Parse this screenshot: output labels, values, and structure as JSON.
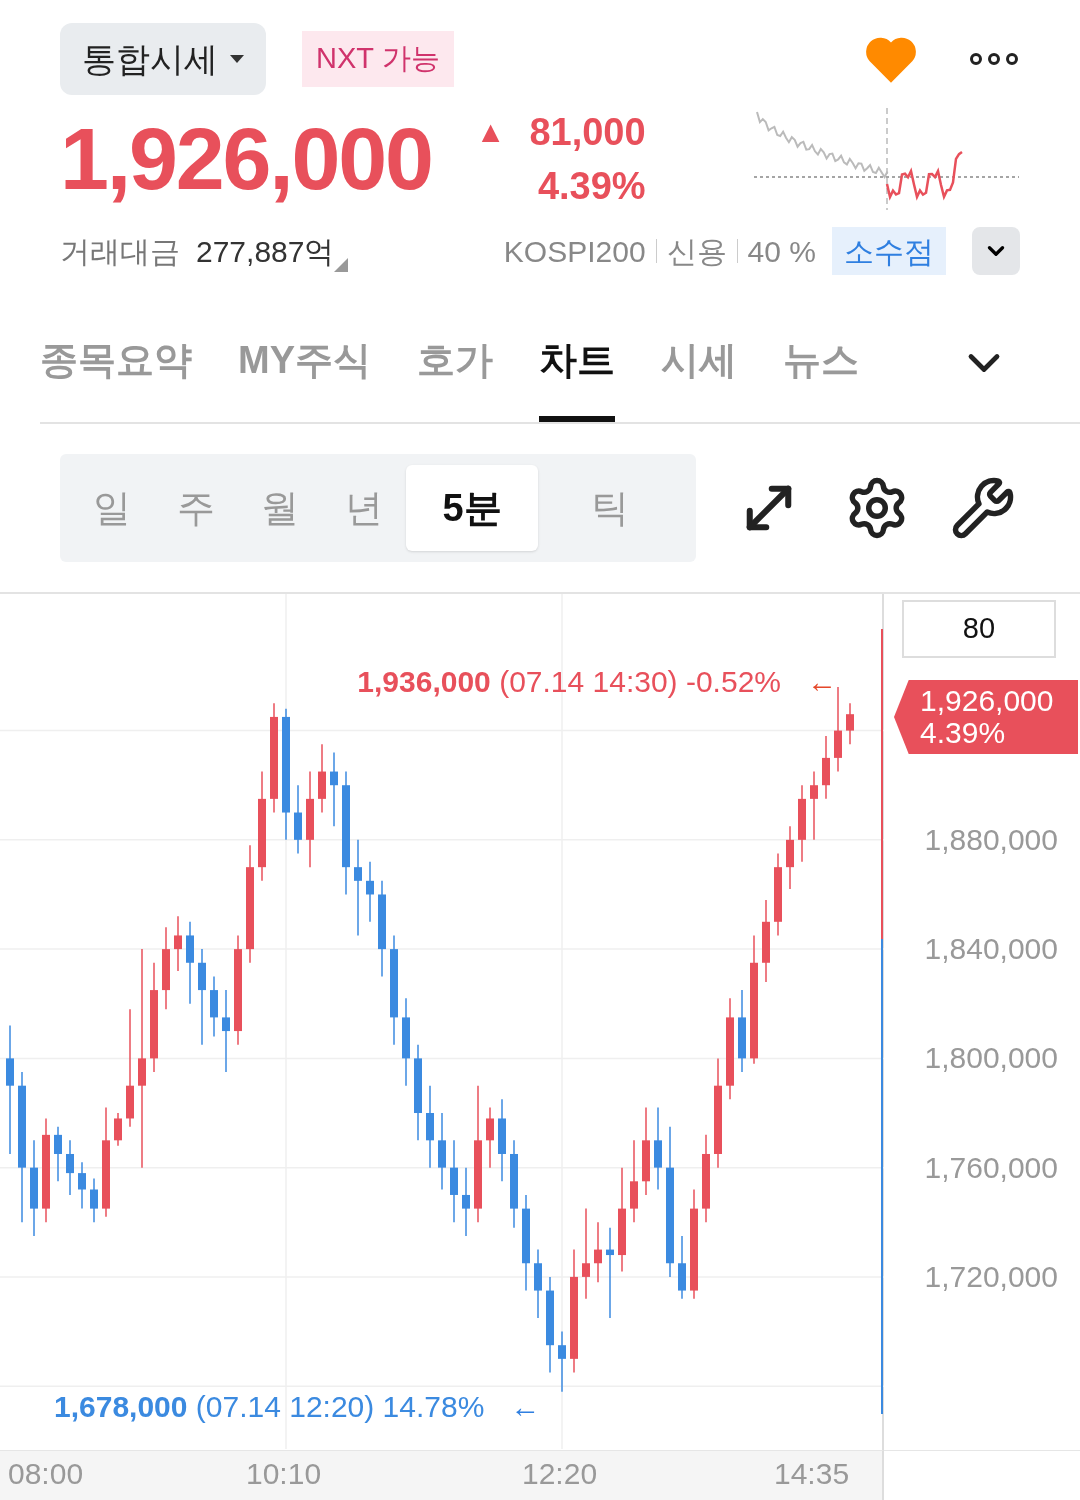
{
  "header": {
    "market_selector": "통합시세",
    "nxt_badge": "NXT 가능",
    "favorite": {
      "on": true
    },
    "price": "1,926,000",
    "change": {
      "arrow": "▲",
      "amount": "81,000",
      "percent": "4.39%"
    },
    "trade_value_label": "거래대금",
    "trade_value": "277,887억",
    "tags": [
      "KOSPI200",
      "신용",
      "40 %"
    ],
    "decimal_button": "소수점"
  },
  "tabs": [
    {
      "label": "종목요약",
      "selected": false
    },
    {
      "label": "MY주식",
      "selected": false
    },
    {
      "label": "호가",
      "selected": false
    },
    {
      "label": "차트",
      "selected": true
    },
    {
      "label": "시세",
      "selected": false
    },
    {
      "label": "뉴스",
      "selected": false
    }
  ],
  "periods": [
    {
      "label": "일",
      "selected": false
    },
    {
      "label": "주",
      "selected": false
    },
    {
      "label": "월",
      "selected": false
    },
    {
      "label": "년",
      "selected": false
    },
    {
      "label": "5분",
      "selected": true
    },
    {
      "label": "틱",
      "selected": false
    }
  ],
  "chart": {
    "count_field": "80",
    "current_price": "1,926,000",
    "current_percent": "4.39%",
    "high": {
      "price": "1,936,000",
      "detail": "(07.14 14:30) -0.52%",
      "arrow": "←"
    },
    "low": {
      "price": "1,678,000",
      "detail": "(07.14 12:20) 14.78%",
      "arrow": "←"
    },
    "chart_data": {
      "type": "candlestick",
      "grid": true,
      "categories": [
        null,
        null,
        null,
        "08:00",
        null,
        null,
        null,
        null,
        null,
        null,
        null,
        null,
        null,
        null,
        null,
        null,
        null,
        null,
        null,
        null,
        null,
        null,
        null,
        "10:10",
        null,
        null,
        null,
        null,
        null,
        null,
        null,
        null,
        null,
        null,
        null,
        null,
        null,
        null,
        null,
        null,
        null,
        null,
        null,
        null,
        null,
        null,
        "12:20",
        null,
        null,
        null,
        null,
        null,
        null,
        null,
        null,
        null,
        null,
        null,
        null,
        null,
        null,
        null,
        null,
        null,
        null,
        null,
        null,
        "14:35",
        null,
        null,
        null
      ],
      "ohlc": [
        [
          1800000,
          1812000,
          1765000,
          1790000
        ],
        [
          1790000,
          1795000,
          1740000,
          1760000
        ],
        [
          1760000,
          1770000,
          1735000,
          1745000
        ],
        [
          1745000,
          1778000,
          1740000,
          1772000
        ],
        [
          1772000,
          1775000,
          1755000,
          1765000
        ],
        [
          1765000,
          1770000,
          1750000,
          1758000
        ],
        [
          1758000,
          1762000,
          1745000,
          1752000
        ],
        [
          1752000,
          1756000,
          1740000,
          1745000
        ],
        [
          1745000,
          1782000,
          1742000,
          1770000
        ],
        [
          1770000,
          1780000,
          1768000,
          1778000
        ],
        [
          1778000,
          1818000,
          1775000,
          1790000
        ],
        [
          1790000,
          1840000,
          1760000,
          1800000
        ],
        [
          1800000,
          1835000,
          1795000,
          1825000
        ],
        [
          1825000,
          1848000,
          1818000,
          1840000
        ],
        [
          1840000,
          1852000,
          1832000,
          1845000
        ],
        [
          1845000,
          1850000,
          1820000,
          1835000
        ],
        [
          1835000,
          1840000,
          1805000,
          1825000
        ],
        [
          1825000,
          1830000,
          1808000,
          1815000
        ],
        [
          1815000,
          1825000,
          1795000,
          1810000
        ],
        [
          1810000,
          1845000,
          1805000,
          1840000
        ],
        [
          1840000,
          1878000,
          1835000,
          1870000
        ],
        [
          1870000,
          1905000,
          1865000,
          1895000
        ],
        [
          1895000,
          1930000,
          1890000,
          1925000
        ],
        [
          1925000,
          1928000,
          1880000,
          1890000
        ],
        [
          1890000,
          1900000,
          1875000,
          1880000
        ],
        [
          1880000,
          1905000,
          1870000,
          1895000
        ],
        [
          1895000,
          1915000,
          1890000,
          1905000
        ],
        [
          1905000,
          1912000,
          1885000,
          1900000
        ],
        [
          1900000,
          1905000,
          1860000,
          1870000
        ],
        [
          1870000,
          1880000,
          1845000,
          1865000
        ],
        [
          1865000,
          1872000,
          1850000,
          1860000
        ],
        [
          1860000,
          1865000,
          1830000,
          1840000
        ],
        [
          1840000,
          1845000,
          1805000,
          1815000
        ],
        [
          1815000,
          1822000,
          1790000,
          1800000
        ],
        [
          1800000,
          1805000,
          1770000,
          1780000
        ],
        [
          1780000,
          1790000,
          1760000,
          1770000
        ],
        [
          1770000,
          1780000,
          1752000,
          1760000
        ],
        [
          1760000,
          1770000,
          1740000,
          1750000
        ],
        [
          1750000,
          1760000,
          1735000,
          1745000
        ],
        [
          1745000,
          1790000,
          1740000,
          1770000
        ],
        [
          1770000,
          1782000,
          1760000,
          1778000
        ],
        [
          1778000,
          1785000,
          1755000,
          1765000
        ],
        [
          1765000,
          1770000,
          1738000,
          1745000
        ],
        [
          1745000,
          1750000,
          1715000,
          1725000
        ],
        [
          1725000,
          1730000,
          1705000,
          1715000
        ],
        [
          1715000,
          1720000,
          1685000,
          1695000
        ],
        [
          1695000,
          1700000,
          1678000,
          1690000
        ],
        [
          1690000,
          1730000,
          1685000,
          1720000
        ],
        [
          1720000,
          1745000,
          1712000,
          1725000
        ],
        [
          1725000,
          1740000,
          1718000,
          1730000
        ],
        [
          1730000,
          1738000,
          1705000,
          1728000
        ],
        [
          1728000,
          1760000,
          1722000,
          1745000
        ],
        [
          1745000,
          1770000,
          1740000,
          1755000
        ],
        [
          1755000,
          1782000,
          1750000,
          1770000
        ],
        [
          1770000,
          1782000,
          1752000,
          1760000
        ],
        [
          1760000,
          1775000,
          1720000,
          1725000
        ],
        [
          1725000,
          1735000,
          1712000,
          1715000
        ],
        [
          1715000,
          1752000,
          1712000,
          1745000
        ],
        [
          1745000,
          1772000,
          1740000,
          1765000
        ],
        [
          1765000,
          1800000,
          1760000,
          1790000
        ],
        [
          1790000,
          1822000,
          1785000,
          1815000
        ],
        [
          1815000,
          1825000,
          1795000,
          1800000
        ],
        [
          1800000,
          1845000,
          1798000,
          1835000
        ],
        [
          1835000,
          1858000,
          1828000,
          1850000
        ],
        [
          1850000,
          1875000,
          1845000,
          1870000
        ],
        [
          1870000,
          1885000,
          1862000,
          1880000
        ],
        [
          1880000,
          1900000,
          1872000,
          1895000
        ],
        [
          1895000,
          1905000,
          1880000,
          1900000
        ],
        [
          1900000,
          1918000,
          1895000,
          1910000
        ],
        [
          1910000,
          1936000,
          1905000,
          1920000
        ],
        [
          1920000,
          1930000,
          1915000,
          1926000
        ]
      ],
      "ylim": [
        1657000,
        1970000
      ],
      "yticks": [
        {
          "value": 1880000,
          "label": "1,880,000"
        },
        {
          "value": 1840000,
          "label": "1,840,000"
        },
        {
          "value": 1800000,
          "label": "1,800,000"
        },
        {
          "value": 1760000,
          "label": "1,760,000"
        },
        {
          "value": 1720000,
          "label": "1,720,000"
        }
      ]
    }
  }
}
